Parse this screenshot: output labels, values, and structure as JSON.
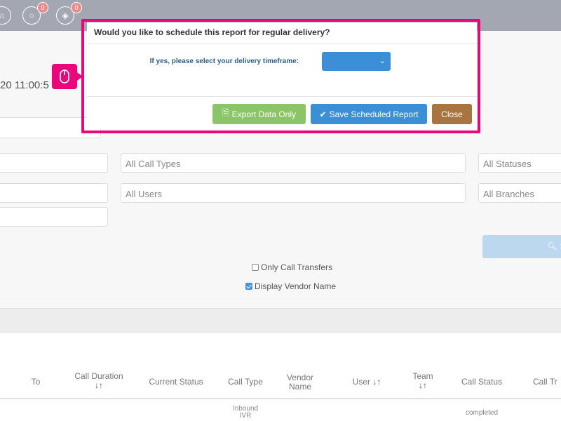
{
  "topbar": {
    "icons": [
      {
        "name": "home-icon"
      },
      {
        "name": "chat-icon",
        "badge": "0"
      },
      {
        "name": "ticket-icon",
        "badge": "0"
      }
    ]
  },
  "page": {
    "datetime_fragment": "20 11:00:5"
  },
  "filters": {
    "call_types_placeholder": "All Call Types",
    "statuses_placeholder": "All Statuses",
    "users_placeholder": "All Users",
    "branches_placeholder": "All Branches",
    "search_label": "S"
  },
  "options": {
    "only_call_transfers": {
      "label": "Only Call Transfers",
      "checked": false
    },
    "display_vendor_name": {
      "label": "Display Vendor Name",
      "checked": true
    }
  },
  "table": {
    "columns": [
      "To",
      "Call Duration",
      "Current Status",
      "Call Type",
      "Vendor Name",
      "User",
      "Team",
      "Call Status",
      "Call Tr"
    ],
    "first_row": {
      "call_type": "Inbound IVR",
      "call_status": "completed"
    }
  },
  "modal": {
    "title": "Would you like to schedule this report for regular delivery?",
    "prompt": "If yes, please select your delivery timeframe:",
    "timeframe_value": "",
    "export_button": "Export Data Only",
    "save_button": "Save Scheduled Report",
    "close_button": "Close",
    "highlight_color": "#e8087c"
  }
}
